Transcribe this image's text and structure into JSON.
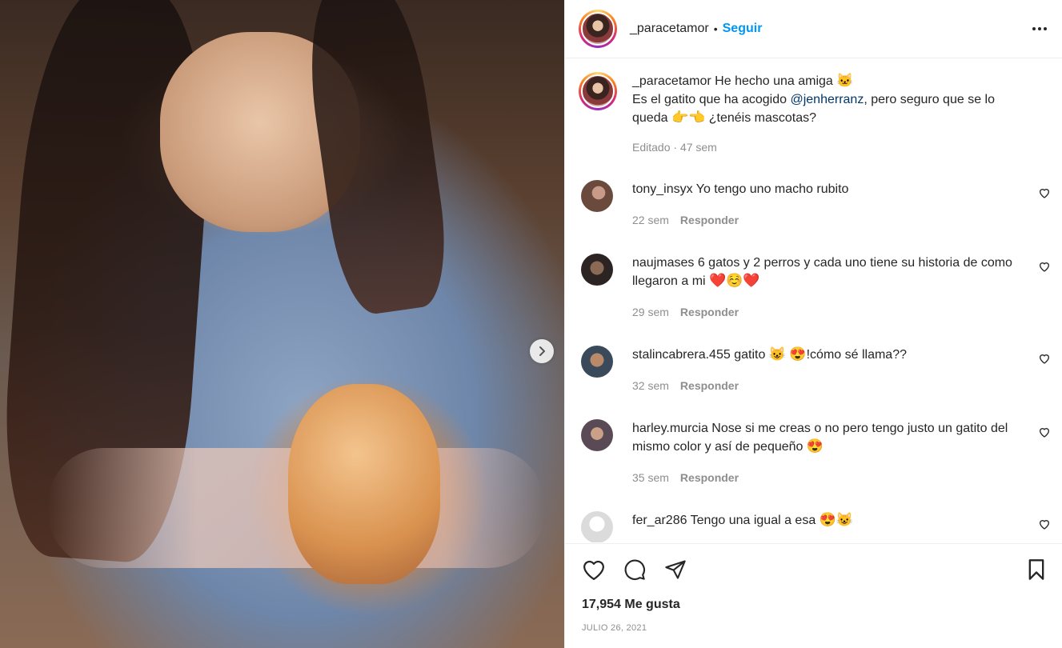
{
  "post": {
    "username": "_paracetamor",
    "dot": "•",
    "follow_label": "Seguir",
    "more_icon": "ellipsis-icon"
  },
  "caption": {
    "username": "_paracetamor",
    "text_1": "He hecho una amiga",
    "emoji_1": "🐱",
    "text_2": "Es el gatito que ha acogido",
    "mention": "@jenherranz",
    "text_3": ", pero seguro que se lo queda",
    "emoji_2": "👉👈",
    "text_4": "¿tenéis mascotas?",
    "meta": "Editado · 47 sem"
  },
  "comments": [
    {
      "username": "tony_insyx",
      "text": "Yo tengo uno macho rubito",
      "age": "22 sem",
      "reply_label": "Responder",
      "avatar_color": "#6b4a3e"
    },
    {
      "username": "naujmases",
      "text": "6 gatos y 2 perros y cada uno tiene su historia de como llegaron a mi",
      "emoji": "❤️☺️❤️",
      "age": "29 sem",
      "reply_label": "Responder",
      "avatar_color": "#3d3430"
    },
    {
      "username": "stalincabrera.455",
      "text": "gatito",
      "emoji_a": "😺",
      "emoji_b": "😍",
      "text_b": "!cómo sé llama??",
      "age": "32 sem",
      "reply_label": "Responder",
      "avatar_color": "#4a5a6a"
    },
    {
      "username": "harley.murcia",
      "text": "Nose si me creas o no pero tengo justo un gatito del mismo color y así de pequeño",
      "emoji": "😍",
      "age": "35 sem",
      "reply_label": "Responder",
      "avatar_color": "#5a4a55"
    },
    {
      "username": "fer_ar286",
      "text": "Tengo una igual a esa",
      "emoji": "😍😺",
      "avatar_color": "#dbdbdb"
    }
  ],
  "actions": {
    "likes": "17,954 Me gusta",
    "date": "JULIO 26, 2021"
  },
  "colors": {
    "accent": "#0095f6",
    "mention": "#00376b",
    "muted": "#8e8e8e",
    "text": "#262626"
  }
}
